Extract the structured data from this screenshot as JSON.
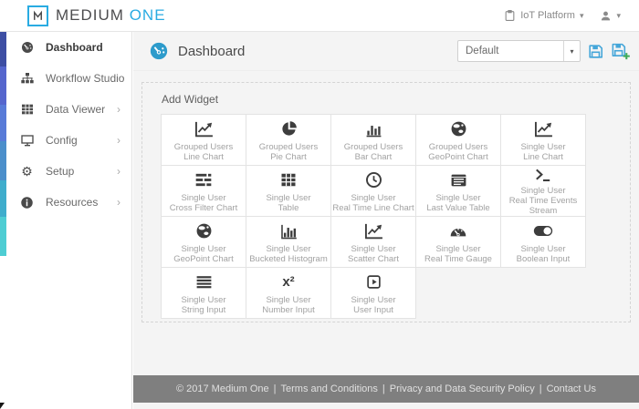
{
  "brand": {
    "mark": "M",
    "name_primary": "MEDIUM",
    "name_secondary": "ONE",
    "accent_color": "#29abe2"
  },
  "top_bar": {
    "platform_label": "IoT Platform"
  },
  "glyphs": {
    "caret_down": "▾",
    "chevron_right": "›",
    "x2": "x²",
    "terminal": "›_",
    "gears": "⚙⚙"
  },
  "sidebar": {
    "items": [
      {
        "label": "Dashboard",
        "icon": "gauge-icon",
        "active": true,
        "has_submenu": false
      },
      {
        "label": "Workflow Studio",
        "icon": "sitemap-icon",
        "active": false,
        "has_submenu": false
      },
      {
        "label": "Data Viewer",
        "icon": "table-icon",
        "active": false,
        "has_submenu": true
      },
      {
        "label": "Config",
        "icon": "monitor-icon",
        "active": false,
        "has_submenu": true
      },
      {
        "label": "Setup",
        "icon": "gears-icon",
        "active": false,
        "has_submenu": true
      },
      {
        "label": "Resources",
        "icon": "info-icon",
        "active": false,
        "has_submenu": true
      }
    ]
  },
  "main": {
    "title": "Dashboard",
    "dashboard_selector": {
      "value": "Default"
    },
    "actions": {
      "save": "save-icon",
      "save_as": "save-plus-icon"
    },
    "add_widget": {
      "title": "Add Widget",
      "widgets": [
        {
          "group": "Grouped Users",
          "type": "Line Chart",
          "icon": "line-chart-icon"
        },
        {
          "group": "Grouped Users",
          "type": "Pie Chart",
          "icon": "pie-chart-icon"
        },
        {
          "group": "Grouped Users",
          "type": "Bar Chart",
          "icon": "bar-chart-icon"
        },
        {
          "group": "Grouped Users",
          "type": "GeoPoint Chart",
          "icon": "globe-icon"
        },
        {
          "group": "Single User",
          "type": "Line Chart",
          "icon": "line-chart-icon"
        },
        {
          "group": "Single User",
          "type": "Cross Filter Chart",
          "icon": "cross-filter-icon"
        },
        {
          "group": "Single User",
          "type": "Table",
          "icon": "table-icon"
        },
        {
          "group": "Single User",
          "type": "Real Time Line Chart",
          "icon": "clock-icon"
        },
        {
          "group": "Single User",
          "type": "Last Value Table",
          "icon": "last-value-table-icon"
        },
        {
          "group": "Single User",
          "type": "Real Time Events Stream",
          "icon": "terminal-icon"
        },
        {
          "group": "Single User",
          "type": "GeoPoint Chart",
          "icon": "globe-icon"
        },
        {
          "group": "Single User",
          "type": "Bucketed Histogram",
          "icon": "histogram-icon"
        },
        {
          "group": "Single User",
          "type": "Scatter Chart",
          "icon": "scatter-chart-icon"
        },
        {
          "group": "Single User",
          "type": "Real Time Gauge",
          "icon": "gauge-icon"
        },
        {
          "group": "Single User",
          "type": "Boolean Input",
          "icon": "toggle-icon"
        },
        {
          "group": "Single User",
          "type": "String Input",
          "icon": "text-lines-icon"
        },
        {
          "group": "Single User",
          "type": "Number Input",
          "icon": "superscript-icon"
        },
        {
          "group": "Single User",
          "type": "User Input",
          "icon": "play-square-icon"
        }
      ]
    }
  },
  "footer": {
    "copyright": "© 2017 Medium One",
    "links": [
      "Terms and Conditions",
      "Privacy and Data Security Policy",
      "Contact Us"
    ],
    "separator": "|"
  },
  "colors": {
    "accent_blue": "#29abe2",
    "title_icon_blue": "#2d9bcb",
    "save_icon_blue": "#45a6d9",
    "save_plus_green": "#3faa58",
    "footer_bg": "#7f7f7f",
    "content_bg": "#f4f4f4",
    "strip_gradient": [
      "#3d4ea3",
      "#5566cd",
      "#587bd8",
      "#4b8fcb",
      "#3fadcc",
      "#4ecdd3"
    ]
  }
}
